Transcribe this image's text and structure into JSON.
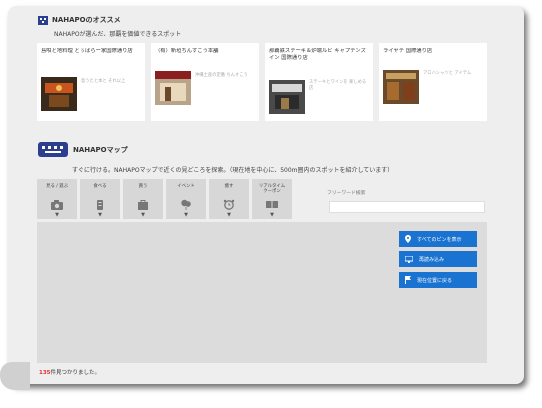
{
  "recommend": {
    "title": "NAHAPOのオススメ",
    "subtitle": "NAHAPOが選んだ、那覇を価値できるスポット",
    "cards": [
      {
        "title": "島唄と地料理 とぅばらー家国際通り店",
        "desc": "島うたと本と\nそれ以上"
      },
      {
        "title": "（有）新垣ちんすこう本舗",
        "desc": "沖縄土産の定番\nちんすこう"
      },
      {
        "title": "那覇鉄ステーキ＆炉端ルビ キャプテンズイン 国際通り店",
        "desc": "ステーキとワインを\n楽しめる店"
      },
      {
        "title": "ライヤテ 国際通り店",
        "desc": "アロハシャツと\nアイテム"
      }
    ]
  },
  "map_section": {
    "title": "NAHAPOマップ",
    "subtitle": "すぐに行ける。NAHAPOマップで近くの見どころを探索。（現在地を中心に、500m圏内のスポットを紹介しています）",
    "categories": [
      {
        "label": "見る / 遊ぶ",
        "icon": "camera-icon"
      },
      {
        "label": "食べる",
        "icon": "food-icon"
      },
      {
        "label": "買う",
        "icon": "shopping-bag-icon"
      },
      {
        "label": "イベント",
        "icon": "balloon-icon"
      },
      {
        "label": "癒す",
        "icon": "alarm-clock-icon"
      },
      {
        "label": "リアルタイム\nクーポン",
        "icon": "coupon-icon"
      }
    ],
    "arrow": "▼",
    "freeword_label": "フリーワード検索",
    "freeword_placeholder": "",
    "buttons": {
      "show_all": "すべてのピンを表示",
      "redraw": "再読み込み",
      "current": "現在位置に戻る"
    }
  },
  "footer": {
    "count": "135",
    "suffix": "件見つかりました。"
  },
  "colors": {
    "accent": "#1a73d0",
    "logo": "#2c3e8f",
    "count": "#dd3333"
  }
}
